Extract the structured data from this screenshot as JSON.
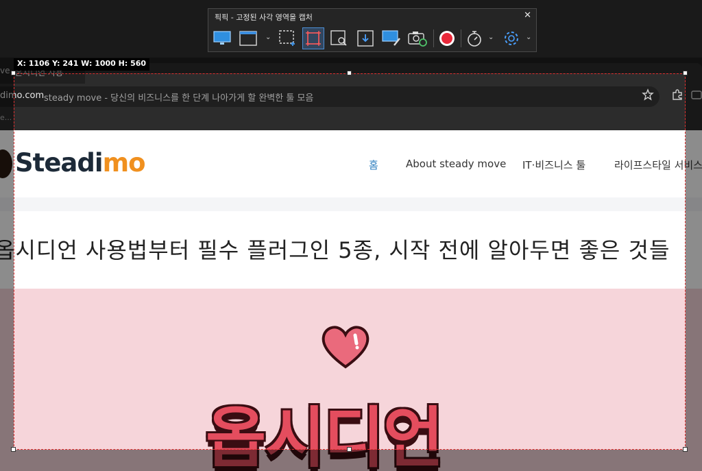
{
  "capture_tool": {
    "title": "픽픽 - 고정된 사각 영역을 캡처",
    "close_glyph": "✕",
    "buttons": [
      {
        "name": "capture-fullscreen-icon"
      },
      {
        "name": "capture-window-icon"
      },
      {
        "name": "capture-region-icon"
      },
      {
        "name": "capture-fixed-region-icon",
        "active": true
      },
      {
        "name": "capture-scroll-icon"
      },
      {
        "name": "capture-download-icon"
      },
      {
        "name": "capture-screen-edit-icon"
      },
      {
        "name": "capture-repeat-camera-icon"
      },
      {
        "name": "record-icon",
        "color": "#e8283a"
      },
      {
        "name": "timer-icon"
      },
      {
        "name": "settings-gear-icon"
      }
    ],
    "selection_readout": "X: 1106 Y: 241 W: 1000 H: 560"
  },
  "browser": {
    "tab_fragment": "ve",
    "tab_fragment_2": "온시디언 사용",
    "url_host": "dimo.com",
    "page_title": "steady move - 당신의 비즈니스를 한 단계 나아가게 할 완벽한 툴 모음",
    "bookmark_fragment": "e..."
  },
  "site": {
    "logo_part1": "Steadi",
    "logo_part2": "mo",
    "nav": [
      "홈",
      "About steady move",
      "IT·비즈니스 툴",
      "라이프스타일 서비스"
    ],
    "headline": "옵시디언 사용법부터 필수 플러그인 5종, 시작 전에 알아두면 좋은 것들",
    "hero_text": "옵시디언",
    "colors": {
      "logo_dark": "#1d2a38",
      "logo_accent": "#f0901f",
      "nav_active": "#2f7fbf",
      "hero_bg": "#f6d5da",
      "hero_text": "#e44d5e"
    }
  }
}
